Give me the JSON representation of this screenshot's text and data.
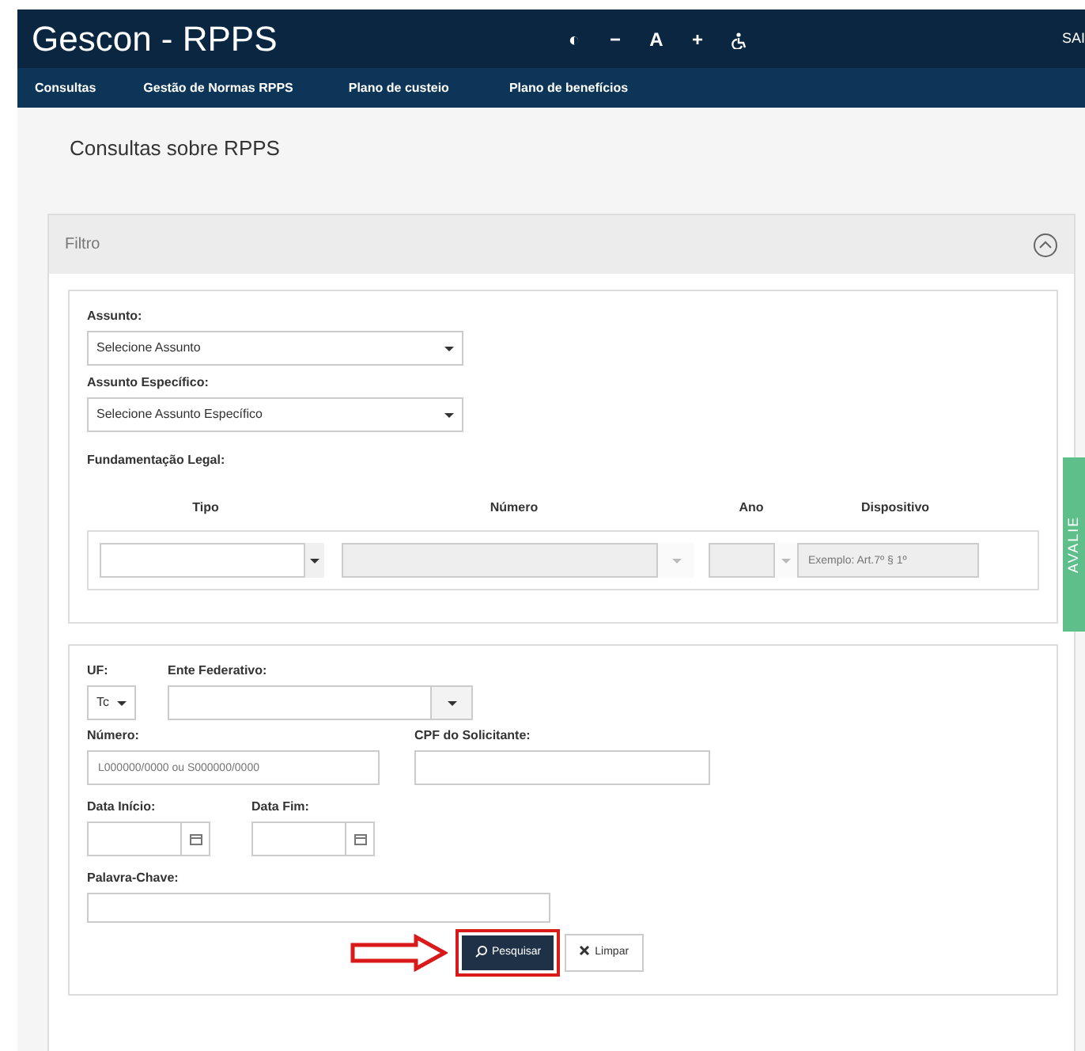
{
  "header": {
    "title": "Gescon - RPPS",
    "tools": [
      "◐",
      "−",
      "A",
      "+"
    ],
    "exit": "SAI"
  },
  "menu": [
    {
      "label": "Consultas"
    },
    {
      "label": "Gestão de Normas RPPS"
    },
    {
      "label": "Plano de custeio"
    },
    {
      "label": "Plano de benefícios"
    }
  ],
  "page_title": "Consultas sobre RPPS",
  "filter": {
    "title": "Filtro",
    "expanded": true
  },
  "subject": {
    "label": "Assunto:",
    "value": "Selecione Assunto"
  },
  "specific_subject": {
    "label": "Assunto Específico:",
    "value": "Selecione Assunto Específico"
  },
  "legal_basis": {
    "label": "Fundamentação Legal:",
    "columns": [
      "Tipo",
      "Número",
      "Ano",
      "Dispositivo"
    ],
    "fields": [
      {
        "kind": "select",
        "disabled": false
      },
      {
        "kind": "select",
        "disabled": true
      },
      {
        "kind": "select",
        "disabled": true
      },
      {
        "kind": "text",
        "disabled": true,
        "placeholder": "Exemplo: Art.7º § 1º"
      }
    ]
  },
  "uf": {
    "label": "UF:",
    "value": "Tc"
  },
  "ente": {
    "label": "Ente Federativo:"
  },
  "numero": {
    "label": "Número:",
    "placeholder": "L000000/0000 ou S000000/0000"
  },
  "cpf": {
    "label": "CPF do Solicitante:"
  },
  "data_inicio": {
    "label": "Data Início:"
  },
  "data_fim": {
    "label": "Data Fim:"
  },
  "palavra": {
    "label": "Palavra-Chave:"
  },
  "buttons": [
    {
      "label": "Pesquisar",
      "kind": "primary",
      "highlighted": true
    },
    {
      "label": "Limpar",
      "kind": "secondary",
      "highlighted": false
    }
  ],
  "feedback_tab": {
    "label": "AVALIE"
  }
}
